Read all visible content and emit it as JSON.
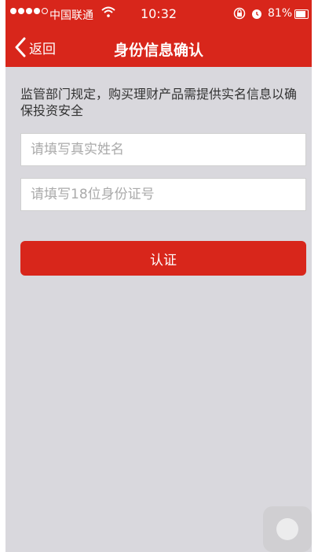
{
  "status_bar": {
    "carrier": "中国联通",
    "time": "10:32",
    "battery": "81%"
  },
  "nav": {
    "back_label": "返回",
    "title": "身份信息确认"
  },
  "form": {
    "notice": "监管部门规定，购买理财产品需提供实名信息以确保投资安全",
    "name_placeholder": "请填写真实姓名",
    "id_placeholder": "请填写18位身份证号",
    "submit_label": "认证"
  },
  "colors": {
    "accent": "#d8261b",
    "background": "#d9d8dd"
  }
}
